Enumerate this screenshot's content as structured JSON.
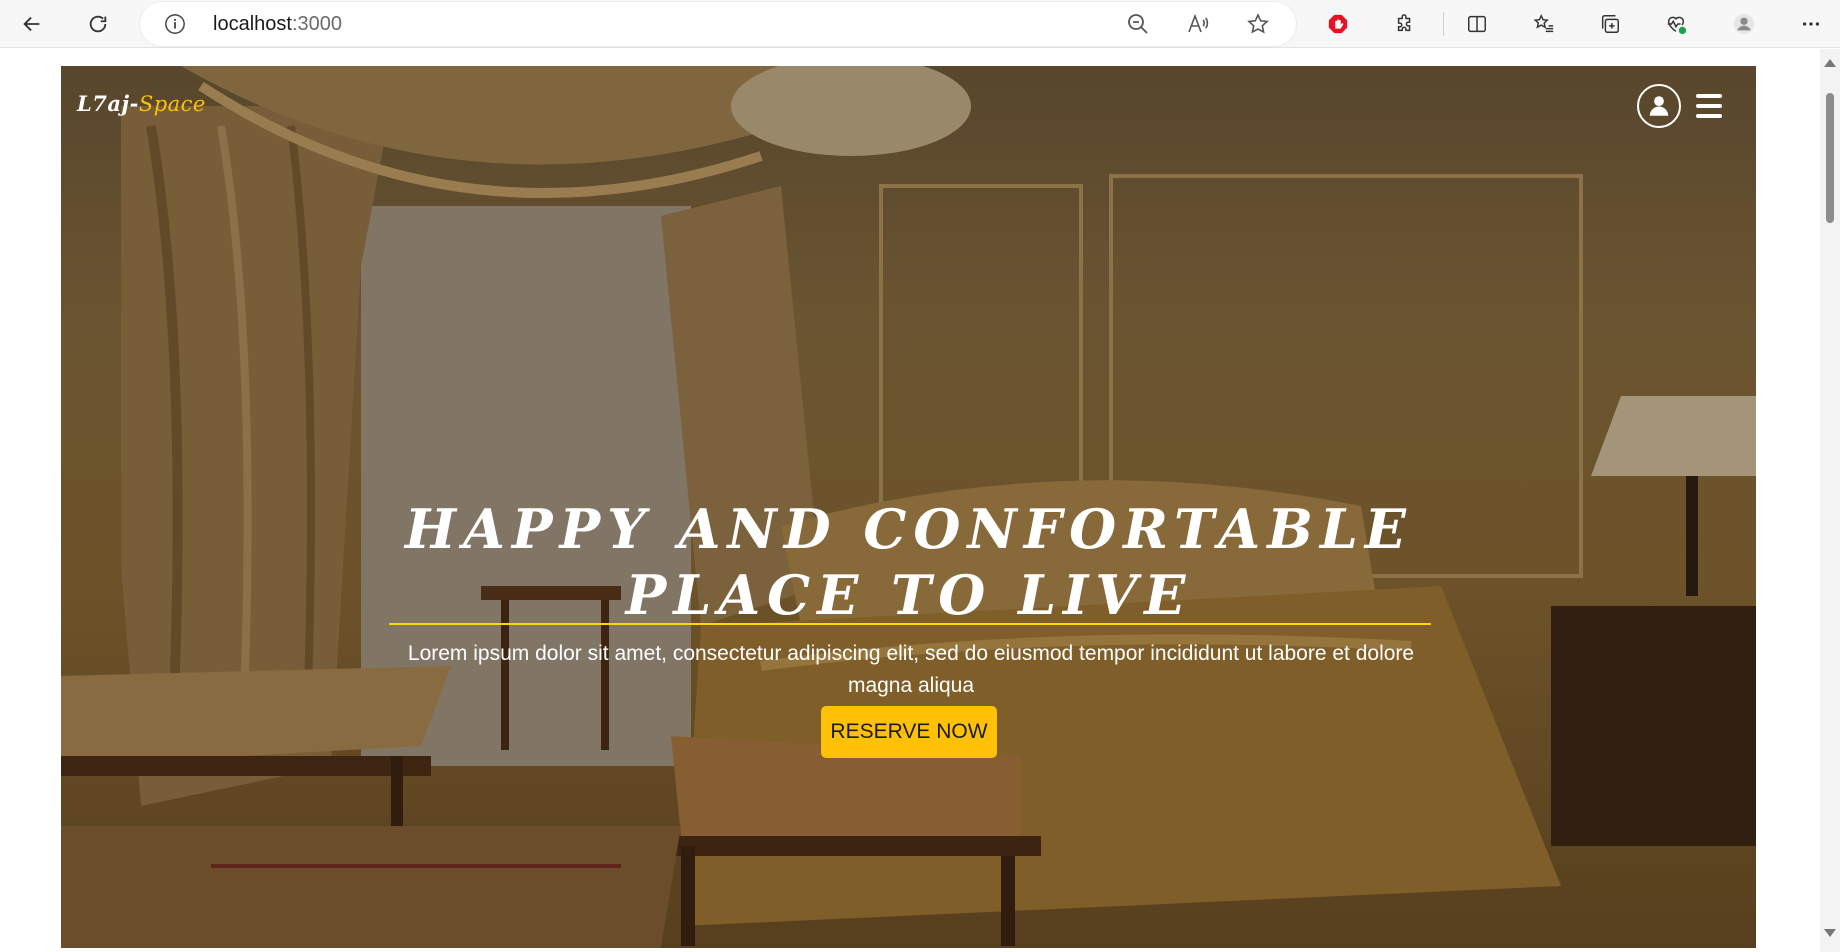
{
  "browser": {
    "url_host": "localhost",
    "url_port": ":3000",
    "icons": [
      "back-icon",
      "refresh-icon",
      "site-info-icon",
      "zoom-out-icon",
      "read-aloud-icon",
      "favorite-star-icon",
      "adblock-icon",
      "extensions-icon",
      "split-screen-icon",
      "favorites-icon",
      "collections-icon",
      "browser-essentials-icon",
      "profile-icon",
      "more-options-icon"
    ]
  },
  "navbar": {
    "logo_main": "L7aj-",
    "logo_accent": "Space",
    "icons": [
      "user-icon",
      "hamburger-menu-icon"
    ]
  },
  "hero": {
    "headline": "HAPPY AND CONFORTABLE PLACE TO LIVE",
    "description": "Lorem ipsum dolor sit amet, consectetur adipiscing elit, sed do eiusmod tempor incididunt ut labore et dolore magna aliqua",
    "cta_label": "RESERVE NOW"
  },
  "colors": {
    "accent": "#ffc107",
    "rule": "#ffd600",
    "adblock": "#e81123"
  }
}
